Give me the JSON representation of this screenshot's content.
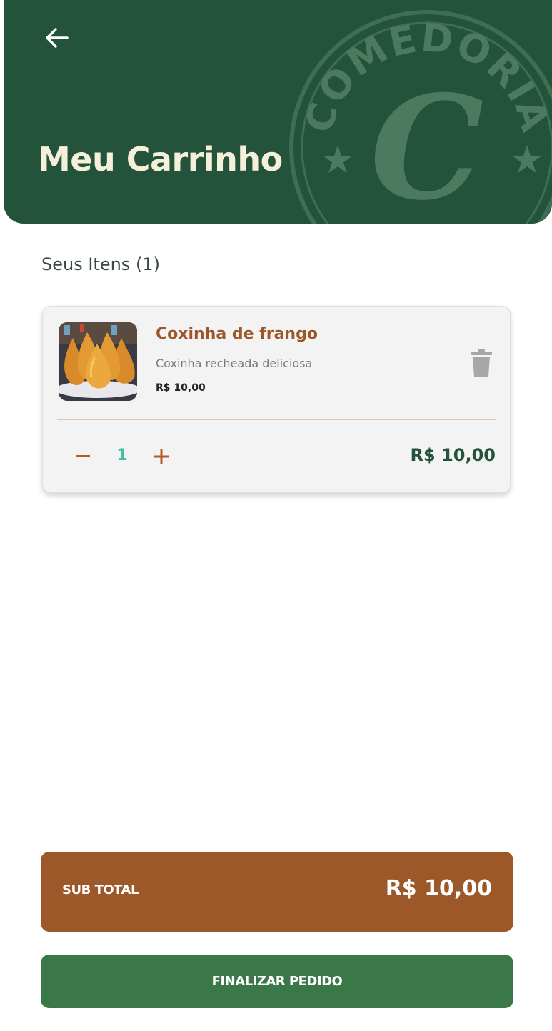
{
  "header": {
    "title": "Meu Carrinho",
    "back_icon": "arrow-left-icon",
    "brand_seal_text": "COMEDORIA",
    "brand_seal_letter": "C",
    "background_color": "#23533a"
  },
  "cart": {
    "section_label": "Seus Itens (1)",
    "items": [
      {
        "name": "Coxinha de frango",
        "description": "Coxinha recheada deliciosa",
        "unit_price": "R$ 10,00",
        "quantity": "1",
        "line_total": "R$ 10,00",
        "image": "coxinha-photo",
        "delete_icon": "trash-icon"
      }
    ]
  },
  "summary": {
    "subtotal_label": "SUB TOTAL",
    "subtotal_value": "R$ 10,00"
  },
  "actions": {
    "checkout_label": "FINALIZAR PEDIDO"
  },
  "colors": {
    "primary_green": "#23533a",
    "button_green": "#3a7848",
    "accent_brown": "#9c5828",
    "quantity_teal": "#3fbfa4"
  }
}
